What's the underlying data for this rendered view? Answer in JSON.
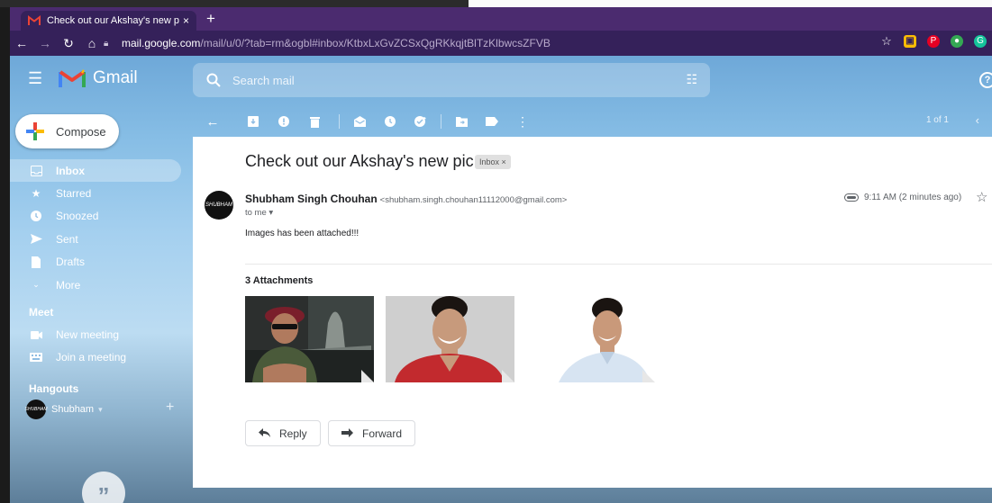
{
  "browser": {
    "tab_title": "Check out our Akshay's new pic",
    "tab_close": "×",
    "new_tab": "+",
    "url_host": "mail.google.com",
    "url_path": "/mail/u/0/?tab=rm&ogbl#inbox/KtbxLxGvZCSxQgRKkqjtBlTzKlbwcsZFVB",
    "accent": "#4b2b6f",
    "toolbar_bg": "#35215a"
  },
  "gmail": {
    "logo_text": "Gmail",
    "search_placeholder": "Search mail",
    "compose_label": "Compose",
    "nav": [
      {
        "label": "Inbox",
        "icon": "inbox-icon"
      },
      {
        "label": "Starred",
        "icon": "star-icon"
      },
      {
        "label": "Snoozed",
        "icon": "clock-icon"
      },
      {
        "label": "Sent",
        "icon": "send-icon"
      },
      {
        "label": "Drafts",
        "icon": "draft-icon"
      },
      {
        "label": "More",
        "icon": "chevron-down-icon"
      }
    ],
    "meet": {
      "title": "Meet",
      "items": [
        {
          "label": "New meeting",
          "icon": "videocam-icon"
        },
        {
          "label": "Join a meeting",
          "icon": "keyboard-icon"
        }
      ]
    },
    "hangouts": {
      "title": "Hangouts",
      "user": "Shubham",
      "user_arrow": "▾",
      "add": "+",
      "avatar_text": "SHUBHAM"
    },
    "quote_glyph": "”",
    "help_glyph": "?"
  },
  "toolbar": {
    "pager": "1 of 1",
    "prev": "‹"
  },
  "message": {
    "subject": "Check out our Akshay's new pic",
    "label": "Inbox ×",
    "sender_name": "Shubham Singh Chouhan",
    "sender_email": "<shubham.singh.chouhan11112000@gmail.com>",
    "to": "to me ▾",
    "time": "9:11 AM (2 minutes ago)",
    "star": "☆",
    "body": "Images has been attached!!!",
    "attachments_title": "3 Attachments",
    "reply_label": "Reply",
    "forward_label": "Forward",
    "avatar_text": "SHUBHAM"
  }
}
